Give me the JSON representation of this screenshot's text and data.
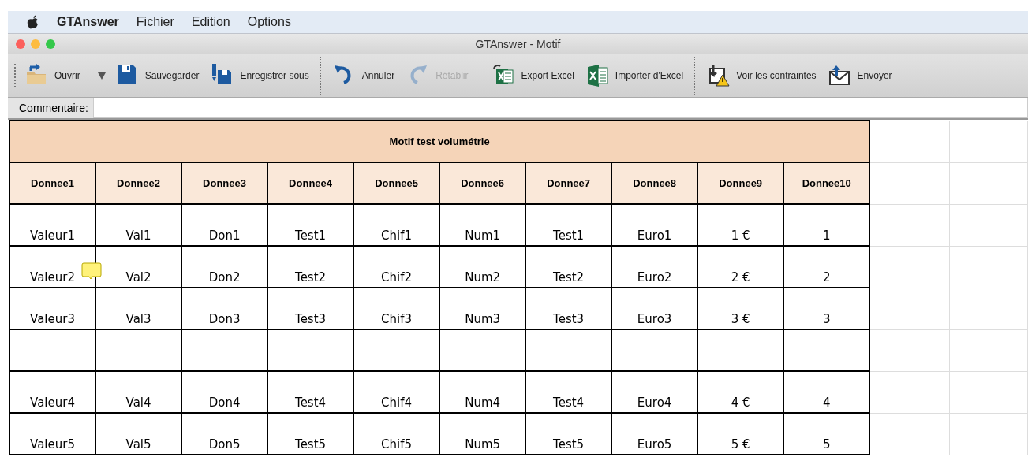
{
  "menu_bar": {
    "app_name": "GTAnswer",
    "items": [
      "Fichier",
      "Edition",
      "Options"
    ]
  },
  "window": {
    "title": "GTAnswer - Motif"
  },
  "toolbar": {
    "groups": [
      [
        {
          "kind": "open",
          "label": "Ouvrir",
          "disabled": false,
          "dropdown": true
        },
        {
          "kind": "save",
          "label": "Sauvegarder",
          "disabled": false
        },
        {
          "kind": "save_as",
          "label": "Enregistrer sous",
          "disabled": false
        }
      ],
      [
        {
          "kind": "undo",
          "label": "Annuler",
          "disabled": false
        },
        {
          "kind": "redo",
          "label": "Rétablir",
          "disabled": true
        }
      ],
      [
        {
          "kind": "export_excel",
          "label": "Export Excel",
          "disabled": false
        },
        {
          "kind": "import_excel",
          "label": "Importer d'Excel",
          "disabled": false
        }
      ],
      [
        {
          "kind": "constraints",
          "label": "Voir les contraintes",
          "disabled": false
        },
        {
          "kind": "send",
          "label": "Envoyer",
          "disabled": false
        }
      ]
    ]
  },
  "comment_field": {
    "label": "Commentaire:"
  },
  "table": {
    "title": "Motif test volumétrie",
    "columns": [
      "Donnee1",
      "Donnee2",
      "Donnee3",
      "Donnee4",
      "Donnee5",
      "Donnee6",
      "Donnee7",
      "Donnee8",
      "Donnee9",
      "Donnee10"
    ],
    "rows": [
      {
        "kind": "data",
        "commented": false,
        "cells": [
          "Valeur1",
          "Val1",
          "Don1",
          "Test1",
          "Chif1",
          "Num1",
          "Test1",
          "Euro1",
          "1 €",
          "1"
        ]
      },
      {
        "kind": "data",
        "commented": true,
        "cells": [
          "Valeur2",
          "Val2",
          "Don2",
          "Test2",
          "Chif2",
          "Num2",
          "Test2",
          "Euro2",
          "2 €",
          "2"
        ]
      },
      {
        "kind": "data",
        "commented": false,
        "cells": [
          "Valeur3",
          "Val3",
          "Don3",
          "Test3",
          "Chif3",
          "Num3",
          "Test3",
          "Euro3",
          "3 €",
          "3"
        ]
      },
      {
        "kind": "blank"
      },
      {
        "kind": "data",
        "commented": false,
        "cells": [
          "Valeur4",
          "Val4",
          "Don4",
          "Test4",
          "Chif4",
          "Num4",
          "Test4",
          "Euro4",
          "4 €",
          "4"
        ]
      },
      {
        "kind": "data",
        "commented": false,
        "cells": [
          "Valeur5",
          "Val5",
          "Don5",
          "Test5",
          "Chif5",
          "Num5",
          "Test5",
          "Euro5",
          "5 €",
          "5"
        ]
      }
    ]
  }
}
